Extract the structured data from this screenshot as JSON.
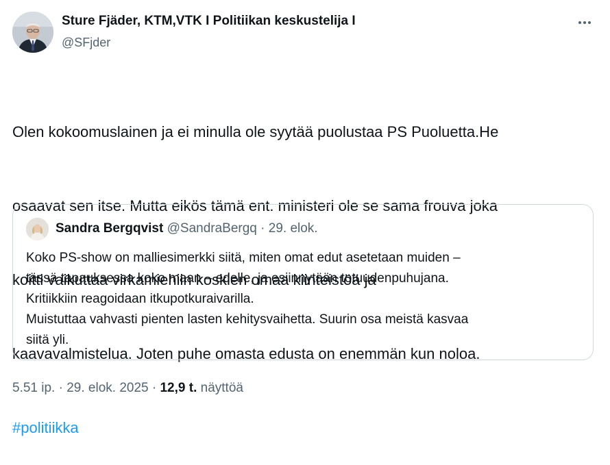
{
  "author": {
    "name": "Sture Fjäder, KTM,VTK I Politiikan keskustelija I",
    "handle": "@SFjder"
  },
  "menu": {
    "more_icon": "more-horizontal-icon"
  },
  "tweet": {
    "lines": [
      "Olen kokoomuslainen ja ei minulla ole syytää puolustaa PS Puoluetta.He",
      "osaavat sen itse. Mutta eikös tämä ent. ministeri ole se sama frouva joka",
      "koitti vaikuttaa virkamiehiin koskien omaa kiinteistöä ja",
      "kaavavalmistelua. Joten puhe omasta edusta on enemmän kun noloa."
    ],
    "hashtag": "#politiikka"
  },
  "quote": {
    "name": "Sandra Bergqvist",
    "handle": "@SandraBergq",
    "separator": " · ",
    "date": "29. elok.",
    "lines": [
      "Koko PS-show on malliesimerkki siitä, miten omat edut asetetaan muiden –",
      "tässä tapauksessa koko maan – edelle, ja esiinnytään totuudenpuhujana.",
      "Kritiikkiin reagoidaan itkupotkuraivarilla.",
      "Muistuttaa vahvasti pienten lasten kehitysvaihetta. Suurin osa meistä kasvaa",
      "siitä yli."
    ]
  },
  "footer": {
    "time": "5.51 ip.",
    "date": "29. elok. 2025",
    "separator": " · ",
    "views_count": "12,9 t.",
    "views_label": "näyttöä"
  },
  "colors": {
    "text": "#0f1419",
    "secondary": "#536471",
    "link": "#1d9bf0",
    "border": "#cfd9de"
  }
}
